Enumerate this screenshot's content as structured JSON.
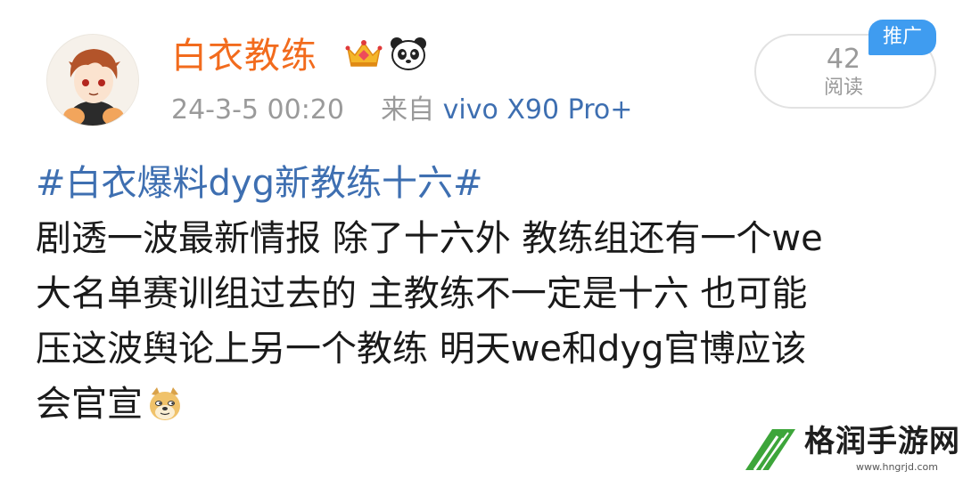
{
  "post": {
    "username": "白衣教练",
    "badges": [
      "crown-icon",
      "panda-icon"
    ],
    "meta": {
      "time": "24-3-5 00:20",
      "from_label": "来自",
      "device": "vivo X90 Pro+"
    },
    "read": {
      "count": "42",
      "label": "阅读",
      "promo": "推广"
    },
    "hashtag": "#白衣爆料dyg新教练十六#",
    "lines": [
      "剧透一波最新情报 除了十六外 教练组还有一个we",
      "大名单赛训组过去的 主教练不一定是十六 也可能",
      "压这波舆论上另一个教练 明天we和dyg官博应该",
      "会官宣"
    ],
    "emoji": "doge-icon"
  },
  "watermark": {
    "name": "格润手游网",
    "url": "www.hngrjd.com",
    "logo": "leaf-logo"
  },
  "colors": {
    "username": "#f26b1d",
    "link": "#3e6fb1",
    "meta": "#9a9a9a",
    "promo_badge": "#3f9cf0"
  }
}
